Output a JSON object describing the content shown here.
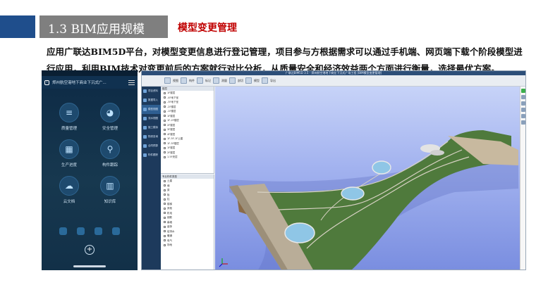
{
  "header": {
    "title": "1.3  BIM应用规模",
    "subtitle": "模型变更管理"
  },
  "body_text": "应用广联达BIM5D平台，对模型变更信息进行登记管理，项目参与方根据需求可以通过手机端、网页端下载个阶段模型进行应用，利用BIM技术对变更前后的方案就行对比分析，从质量安全和经济效益两个方面进行衡量，选择最优方案。",
  "phone": {
    "title": "郑州航空港地下商业下沉式广...",
    "apps": [
      {
        "label": "质量管理",
        "icon": "quality-icon",
        "glyph": "≡"
      },
      {
        "label": "安全管理",
        "icon": "safety-icon",
        "glyph": "◕"
      },
      {
        "label": "生产进度",
        "icon": "progress-chart-icon",
        "glyph": "▦"
      },
      {
        "label": "构件跟踪",
        "icon": "component-track-icon",
        "glyph": "⚲"
      },
      {
        "label": "云文档",
        "icon": "cloud-docs-icon",
        "glyph": "☁"
      },
      {
        "label": "知识库",
        "icon": "knowledge-base-icon",
        "glyph": "▥"
      }
    ],
    "plus": "+"
  },
  "app": {
    "title": "广联达BIM5D 3.5 - 郑州航空港地下商业下沉式广场工程 [BIM模型变更管理]",
    "toolbar": [
      "视图",
      "构件",
      "标记",
      "测量",
      "剖切",
      "模型",
      "导出"
    ],
    "sidebar": [
      {
        "label": "项目资料"
      },
      {
        "label": "数据导入"
      },
      {
        "label": "模型视图",
        "selected": true
      },
      {
        "label": "流水视图"
      },
      {
        "label": "施工模拟"
      },
      {
        "label": "物资查询"
      },
      {
        "label": "合同预算"
      },
      {
        "label": "构件跟踪"
      }
    ],
    "tree1_header": "楼层",
    "tree1": [
      "1F楼层",
      "-4F地下室",
      "-3F地下室",
      "-2F楼层",
      "-1F楼层",
      "1F楼层",
      "1F-2F楼层",
      "2F楼层",
      "3F楼层",
      "4F楼层",
      "1F-5F-1F土建",
      "1F-5F楼层",
      "1F楼层",
      "2F楼层",
      "1.5F夹层"
    ],
    "tree2_header": "专业构件类型",
    "tree2": [
      "土建",
      "墙",
      "梁",
      "板",
      "柱",
      "楼梯",
      "其他",
      "机电",
      "钢筋",
      "幕墙",
      "装饰",
      "给排水",
      "暖通",
      "电气",
      "场地"
    ]
  }
}
